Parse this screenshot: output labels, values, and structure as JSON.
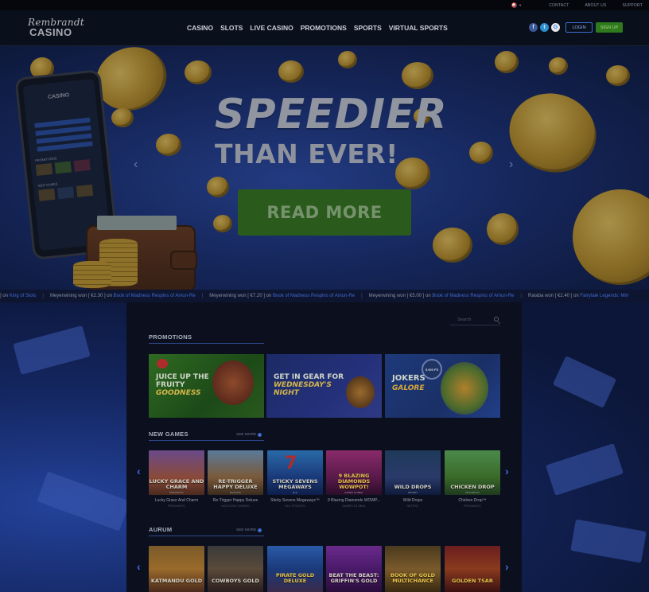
{
  "topbar": {
    "language_selector": "",
    "links": [
      "CONTACT",
      "ABOUT US",
      "SUPPORT"
    ]
  },
  "header": {
    "logo_script": "Rembrandt",
    "logo_word": "CASINO",
    "nav": [
      "CASINO",
      "SLOTS",
      "LIVE CASINO",
      "PROMOTIONS",
      "SPORTS",
      "VIRTUAL SPORTS"
    ],
    "social": [
      "facebook-icon",
      "twitter-icon",
      "google-icon"
    ],
    "login_label": "LOGIN",
    "signup_label": "SIGN UP",
    "colors": {
      "accent": "#3b6fd1",
      "signup": "#2f7a1c"
    }
  },
  "hero": {
    "title": "SPEEDIER",
    "subtitle": "THAN EVER!",
    "cta": "READ MORE",
    "phone_screen_title": "CASINO",
    "phone_labels": [
      "SLOTS",
      "CASINO",
      "SPORTS",
      "LIVE CASINO"
    ],
    "phone_sections": [
      "PROMOTIONS",
      "NEW GAMES"
    ],
    "colors": {
      "cta": "#3b7a1c"
    }
  },
  "ticker": {
    "entries": [
      {
        "prefix": "] on",
        "game": "King of Slots"
      },
      {
        "prefix": "Meyerwining won [ €2.30 ] on",
        "game": "Book of Madness Respins of Amun-Re"
      },
      {
        "prefix": "Meyerwining won [ €7.20 ] on",
        "game": "Book of Madness Respins of Amun-Re"
      },
      {
        "prefix": "Meyerwining won [ €5.00 ] on",
        "game": "Book of Madness Respins of Amun-Re"
      },
      {
        "prefix": "Rataba won [ €2.40 ] on",
        "game": "Fairytale Legends: Mirr"
      }
    ]
  },
  "search": {
    "placeholder": "Search"
  },
  "promotions": {
    "title": "PROMOTIONS",
    "cards": [
      {
        "line1": "JUICE UP THE",
        "line2": "FRUITY",
        "line3": "GOODNESS"
      },
      {
        "line1": "GET IN GEAR FOR",
        "line2": "WEDNESDAY'S",
        "line3": "NIGHT"
      },
      {
        "line1": "JOKERS",
        "line2": "GALORE",
        "badge": "5.000 FS"
      }
    ]
  },
  "new_games": {
    "title": "NEW GAMES",
    "see_more": "SEE MORE",
    "games": [
      {
        "tile": "LUCKY GRACE AND CHARM",
        "provider": "PRAGMATIC",
        "caption": "Lucky Grace And Charm",
        "subcaption": "PRAGMATIC"
      },
      {
        "tile": "RE-TRIGGER HAPPY DELUXE",
        "provider": "BGAMING",
        "caption": "Re-Trigger Happy Deluxe",
        "subcaption": "HACKSAW GAMING"
      },
      {
        "tile": "STICKY SEVENS MEGAWAYS",
        "provider": "ELK",
        "caption": "Sticky Sevens Megaways™",
        "subcaption": "ELK STUDIOS"
      },
      {
        "tile": "9 BLAZING DIAMONDS WOWPOT!",
        "provider": "GAMES GLOBAL",
        "caption": "9 Blazing Diamonds WOWP...",
        "subcaption": "GAMES GLOBAL"
      },
      {
        "tile": "WILD DROPS",
        "provider": "NETENT",
        "caption": "Wild Drops",
        "subcaption": "NETENT"
      },
      {
        "tile": "CHICKEN DROP",
        "provider": "PRAGMATIC",
        "caption": "Chicken Drop™",
        "subcaption": "PRAGMATIC"
      }
    ]
  },
  "aurum": {
    "title": "AURUM",
    "see_more": "SEE MORE",
    "games": [
      {
        "tile": "KATMANDU GOLD"
      },
      {
        "tile": "COWBOYS GOLD"
      },
      {
        "tile": "PIRATE GOLD DELUXE"
      },
      {
        "tile": "BEAT THE BEAST: GRIFFIN'S GOLD"
      },
      {
        "tile": "BOOK OF GOLD MULTICHANCE"
      },
      {
        "tile": "GOLDEN TSAR"
      }
    ]
  },
  "carousel_arrows": {
    "left": "‹",
    "right": "›"
  }
}
